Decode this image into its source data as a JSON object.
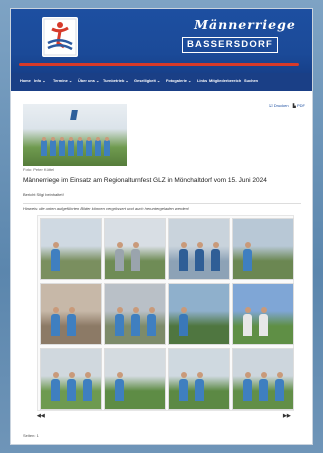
{
  "header": {
    "brand_script": "Männerriege",
    "brand_box": "BASSERSDORF"
  },
  "nav": {
    "items": [
      {
        "label": "Home"
      },
      {
        "label": "Info ⌄"
      },
      {
        "label": "Termine ⌄"
      },
      {
        "label": "Über uns ⌄"
      },
      {
        "label": "Turnbetrieb ⌄"
      },
      {
        "label": "Geselligkeit ⌄"
      },
      {
        "label": "Fotogalerie ⌄"
      },
      {
        "label": "Links"
      },
      {
        "label": "Mitgliederbereich"
      },
      {
        "label": "Suchen"
      }
    ]
  },
  "tools": {
    "print_label": "Drucken",
    "pdf_label": "PDF"
  },
  "article": {
    "photo_credit": "Foto: Peter Küttel",
    "headline": "Männerriege im Einsatz am Regionalturnfest GLZ in Mönchaltdorf vom 15. Juni 2024",
    "author": "Bericht Silgi beinhaltet!",
    "gallery_note": "Hinweis: die unten aufgeführten Bilder können vergrössert und auch heruntergeladen werden!"
  },
  "gallery": {
    "prev_label": "◀◀",
    "next_label": "▶▶",
    "thumbs": [
      {
        "scene": "group-walking",
        "sky": "#cfd9e2",
        "ground": "#7a8f5f",
        "accent": "#3f7fc0"
      },
      {
        "scene": "finish-arch",
        "sky": "#d8dee4",
        "ground": "#6f8c56",
        "accent": "#9aa4ad"
      },
      {
        "scene": "rte-glz-banner",
        "sky": "#c9d3dc",
        "ground": "#8da2b6",
        "accent": "#2f5e96"
      },
      {
        "scene": "seated-group",
        "sky": "#b8c8d6",
        "ground": "#6b8752",
        "accent": "#3f7fc0"
      },
      {
        "scene": "toast",
        "sky": "#c7b8a8",
        "ground": "#8c7a66",
        "accent": "#3f7fc0"
      },
      {
        "scene": "table-group",
        "sky": "#b9c0c7",
        "ground": "#7d8b6a",
        "accent": "#3f7fc0"
      },
      {
        "scene": "portrait-cap",
        "sky": "#8fb0cc",
        "ground": "#4f7640",
        "accent": "#3a78b8"
      },
      {
        "scene": "field-panorama",
        "sky": "#7fa6d6",
        "ground": "#5f8f45",
        "accent": "#e7e7e7"
      },
      {
        "scene": "throwers",
        "sky": "#d0d8de",
        "ground": "#6e9a50",
        "accent": "#3f7fc0"
      },
      {
        "scene": "walker",
        "sky": "#d4dbe0",
        "ground": "#5e8c45",
        "accent": "#3f7fc0"
      },
      {
        "scene": "reaching",
        "sky": "#cfd9e0",
        "ground": "#5c8944",
        "accent": "#3f7fc0"
      },
      {
        "scene": "ball-throw",
        "sky": "#cdd6dd",
        "ground": "#628f48",
        "accent": "#3f7fc0"
      }
    ]
  },
  "footer": {
    "page_label": "Seiten: 1"
  }
}
